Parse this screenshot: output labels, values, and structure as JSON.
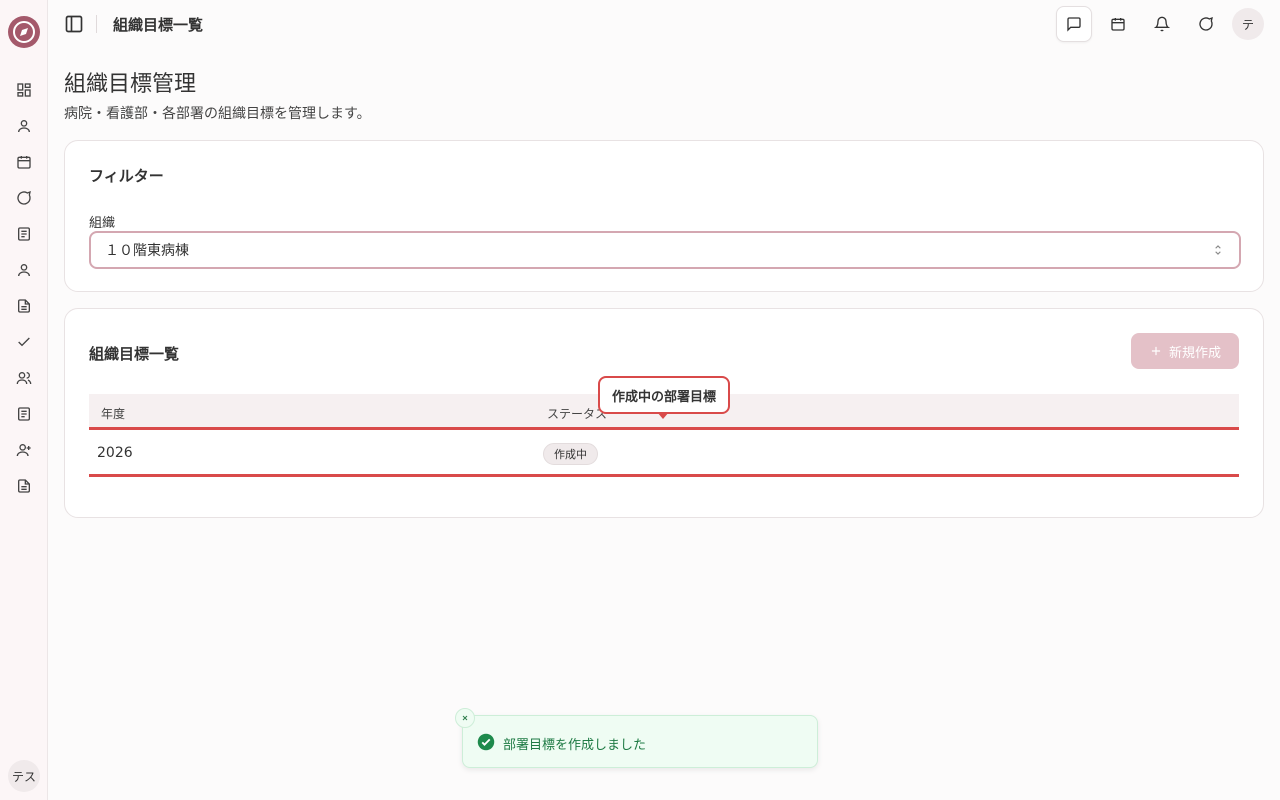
{
  "header": {
    "title": "組織目標一覧",
    "avatar_initial": "テ"
  },
  "sidebar": {
    "user_initials": "テス"
  },
  "page": {
    "title": "組織目標管理",
    "description": "病院・看護部・各部署の組織目標を管理します。"
  },
  "filter": {
    "title": "フィルター",
    "org_label": "組織",
    "org_value": "１０階東病棟"
  },
  "list": {
    "title": "組織目標一覧",
    "new_button": "新規作成",
    "columns": [
      "年度",
      "ステータス"
    ],
    "rows": [
      {
        "year": "2026",
        "status": "作成中"
      }
    ]
  },
  "tooltip": {
    "text": "作成中の部署目標"
  },
  "toast": {
    "message": "部署目標を作成しました"
  },
  "colors": {
    "accent": "#a4596b",
    "highlight": "#d94a4a",
    "success": "#1e7a44"
  }
}
